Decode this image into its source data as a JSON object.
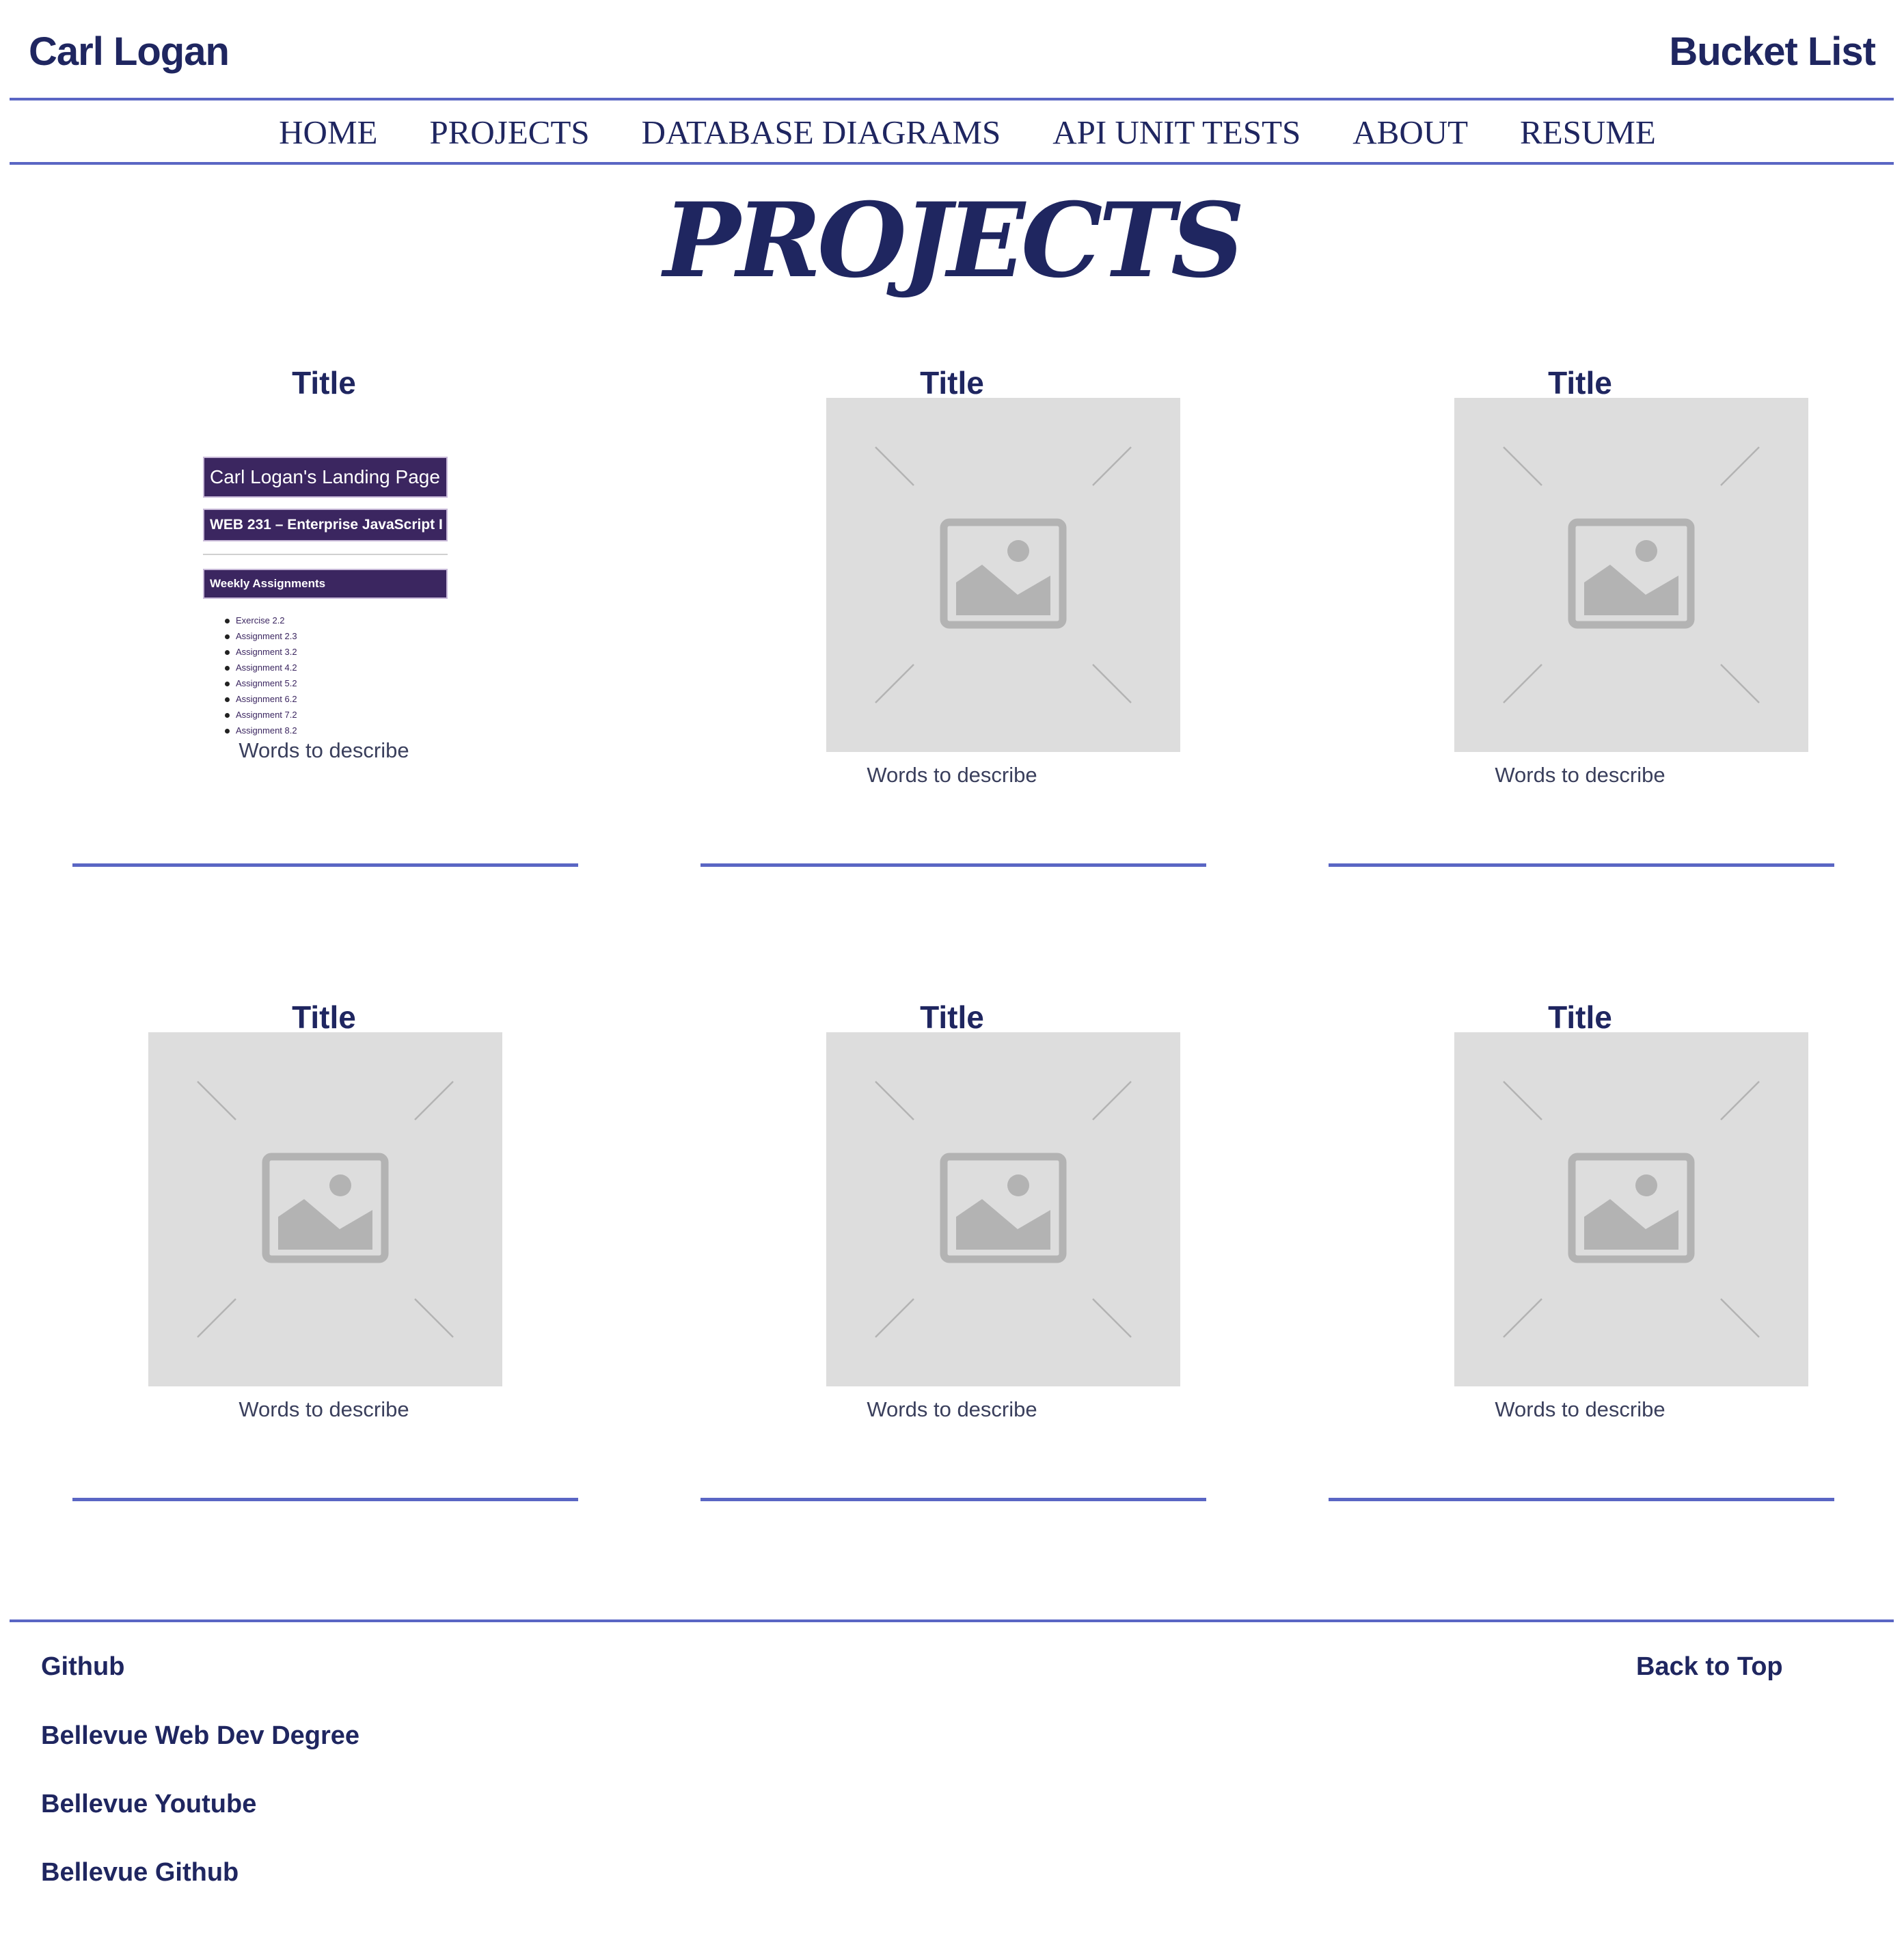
{
  "header": {
    "site_name": "Carl Logan",
    "right_link": "Bucket List"
  },
  "nav": {
    "items": [
      {
        "label": "HOME"
      },
      {
        "label": "PROJECTS"
      },
      {
        "label": "DATABASE DIAGRAMS"
      },
      {
        "label": "API UNIT TESTS"
      },
      {
        "label": "ABOUT"
      },
      {
        "label": "RESUME"
      }
    ]
  },
  "main": {
    "page_title": "PROJECTS",
    "cards": [
      {
        "title": "Title",
        "description": "Words to describe",
        "preview": {
          "heading": "Carl Logan's Landing Page",
          "course": "WEB 231 – Enterprise JavaScript I",
          "section": "Weekly Assignments",
          "items": [
            "Exercise 2.2",
            "Assignment 2.3",
            "Assignment 3.2",
            "Assignment 4.2",
            "Assignment 5.2",
            "Assignment 6.2",
            "Assignment 7.2",
            "Assignment 8.2"
          ]
        }
      },
      {
        "title": "Title",
        "description": "Words to describe",
        "image_icon": "image-placeholder-icon"
      },
      {
        "title": "Title",
        "description": "Words to describe",
        "image_icon": "image-placeholder-icon"
      },
      {
        "title": "Title",
        "description": "Words to describe",
        "image_icon": "image-placeholder-icon"
      },
      {
        "title": "Title",
        "description": "Words to describe",
        "image_icon": "image-placeholder-icon"
      },
      {
        "title": "Title",
        "description": "Words to describe",
        "image_icon": "image-placeholder-icon"
      }
    ]
  },
  "footer": {
    "links": [
      {
        "label": "Github"
      },
      {
        "label": "Bellevue Web Dev Degree"
      },
      {
        "label": "Bellevue Youtube"
      },
      {
        "label": "Bellevue Github"
      }
    ],
    "back_to_top": "Back to Top"
  },
  "colors": {
    "text_primary": "#1f2660",
    "rule_accent": "#5a66c4",
    "placeholder_bg": "#dddddd",
    "placeholder_icon": "#b3b3b3",
    "preview_bar": "#3b2660"
  }
}
